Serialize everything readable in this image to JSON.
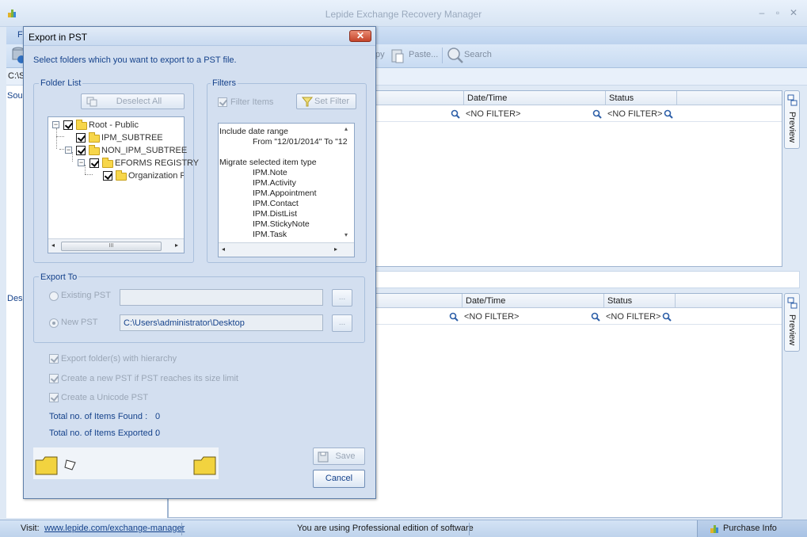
{
  "main_window": {
    "title": "Lepide Exchange Recovery Manager",
    "controls": {
      "minimize": "–",
      "maximize": "▫",
      "close": "✕"
    },
    "menu": {
      "file": "Fi"
    },
    "toolbar": {
      "copy": "py",
      "paste": "Paste...",
      "search": "Search"
    },
    "path": "C:\\S",
    "source_pane": {
      "label": "Sou",
      "columns": [
        "Date/Time",
        "Status"
      ],
      "filters": [
        "<NO FILTER>",
        "<NO FILTER>"
      ],
      "preview_label": "Preview"
    },
    "destination_pane": {
      "label": "Des",
      "columns": [
        "Date/Time",
        "Status"
      ],
      "filters": [
        "<NO FILTER>",
        "<NO FILTER>"
      ],
      "preview_label": "Preview"
    },
    "status_bar": {
      "visit_label": "Visit:",
      "visit_link": "www.lepide.com/exchange-manager",
      "edition_text": "You are using Professional edition of software",
      "purchase_label": "Purchase Info"
    }
  },
  "dialog": {
    "title": "Export in PST",
    "close": "✕",
    "description": "Select folders which you want to export to a PST file.",
    "folder_list": {
      "legend": "Folder List",
      "deselect_all": "Deselect All",
      "tree": [
        {
          "label": "Root - Public",
          "checked": true
        },
        {
          "label": "IPM_SUBTREE",
          "checked": true
        },
        {
          "label": "NON_IPM_SUBTREE",
          "checked": true
        },
        {
          "label": "EFORMS REGISTRY",
          "checked": true
        },
        {
          "label": "Organization For",
          "checked": true
        }
      ],
      "scroll_grip": "III"
    },
    "filters": {
      "legend": "Filters",
      "filter_items_label": "Filter Items",
      "set_filter_label": "Set Filter",
      "lines": [
        "Include date range",
        "From \"12/01/2014\" To \"12",
        "",
        "Migrate selected item type",
        "IPM.Note",
        "IPM.Activity",
        "IPM.Appointment",
        "IPM.Contact",
        "IPM.DistList",
        "IPM.StickyNote",
        "IPM.Task"
      ]
    },
    "export_to": {
      "legend": "Export To",
      "existing_pst_label": "Existing PST",
      "existing_pst_value": "",
      "new_pst_label": "New PST",
      "new_pst_value": "C:\\Users\\administrator\\Desktop",
      "browse_label": "..."
    },
    "options": {
      "hierarchy": "Export folder(s) with hierarchy",
      "new_pst_limit": "Create a new PST if PST reaches its size limit",
      "unicode": "Create a Unicode PST"
    },
    "totals": {
      "found_label": "Total no. of Items Found :",
      "found_value": "0",
      "exported_label": "Total no. of Items Exported :",
      "exported_value": "0"
    },
    "buttons": {
      "save": "Save",
      "cancel": "Cancel"
    }
  }
}
